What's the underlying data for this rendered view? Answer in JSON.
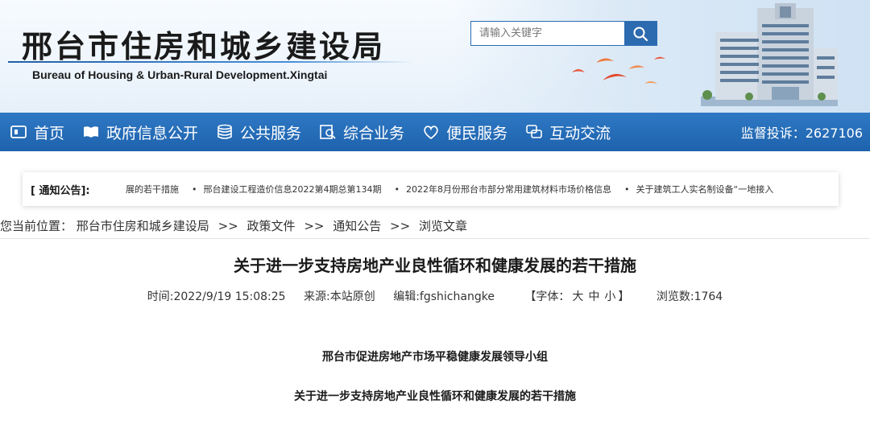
{
  "header": {
    "title_cn": "邢台市住房和城乡建设局",
    "title_en": "Bureau of Housing & Urban-Rural Development.Xingtai",
    "search_placeholder": "请输入关键字"
  },
  "nav": {
    "items": [
      {
        "label": "首页",
        "icon": "home-icon"
      },
      {
        "label": "政府信息公开",
        "icon": "book-icon"
      },
      {
        "label": "公共服务",
        "icon": "database-icon"
      },
      {
        "label": "综合业务",
        "icon": "search-doc-icon"
      },
      {
        "label": "便民服务",
        "icon": "heart-shield-icon"
      },
      {
        "label": "互动交流",
        "icon": "chat-icon"
      }
    ],
    "complaint": "监督投诉：2627106"
  },
  "notice": {
    "label": "[ 通知公告]:",
    "items": [
      "展的若干措施",
      "邢台建设工程造价信息2022第4期总第134期",
      "2022年8月份邢台市部分常用建筑材料市场价格信息",
      "关于建筑工人实名制设备“一地接入"
    ]
  },
  "breadcrumb": {
    "prefix": "您当前位置：",
    "items": [
      "邢台市住房和城乡建设局",
      "政策文件",
      "通知公告",
      "浏览文章"
    ],
    "sep": ">>"
  },
  "article": {
    "title": "关于进一步支持房地产业良性循环和健康发展的若干措施",
    "time": "时间:2022/9/19 15:08:25",
    "source": "来源:本站原创",
    "editor": "编辑:fgshichangke",
    "font_label": "【字体：",
    "font_large": "大",
    "font_medium": "中",
    "font_small": "小",
    "font_end": "】",
    "views": "浏览数:1764",
    "body_line1": "邢台市促进房地产市场平稳健康发展领导小组",
    "body_line2": "关于进一步支持房地产业良性循环和健康发展的若干措施"
  },
  "colors": {
    "nav_blue": "#1e62ad",
    "search_blue": "#2d6bb0"
  }
}
